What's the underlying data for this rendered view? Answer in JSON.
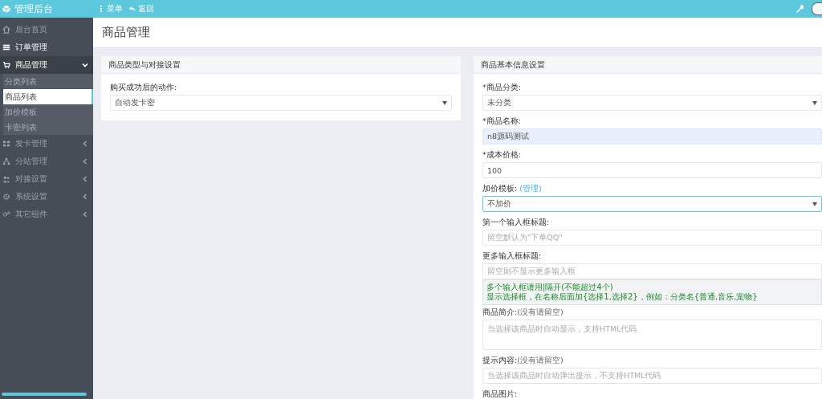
{
  "topbar": {
    "brand": "管理后台",
    "actions": [
      {
        "kind": "menu",
        "label": "菜单"
      },
      {
        "kind": "back",
        "label": "返回"
      }
    ]
  },
  "sidebar": {
    "items": [
      {
        "label": "后台首页",
        "active": false
      },
      {
        "label": "订单管理",
        "active": true
      },
      {
        "label": "商品管理",
        "active": false,
        "expanded": true,
        "children": [
          {
            "label": "分类列表",
            "selected": false
          },
          {
            "label": "商品列表",
            "selected": true
          },
          {
            "label": "加价模板",
            "selected": false
          },
          {
            "label": "卡密列表",
            "selected": false
          }
        ]
      },
      {
        "label": "发卡管理",
        "active": false,
        "expanded": false
      },
      {
        "label": "分站管理",
        "active": false,
        "expanded": false
      },
      {
        "label": "对接设置",
        "active": false,
        "expanded": false
      },
      {
        "label": "系统设置",
        "active": false,
        "expanded": false
      },
      {
        "label": "其它组件",
        "active": false,
        "expanded": false
      }
    ]
  },
  "page_title": "商品管理",
  "panels": [
    {
      "title": "商品类型与对接设置",
      "fields": [
        {
          "kind": "select",
          "label": "购买成功后的动作:",
          "value": "自动发卡密",
          "focused": false,
          "highlighted": false
        }
      ]
    },
    {
      "title": "商品基本信息设置",
      "fields": [
        {
          "kind": "select",
          "label": "*商品分类:",
          "value": "未分类",
          "focused": false,
          "highlighted": false
        },
        {
          "kind": "input",
          "label": "*商品名称:",
          "value": "n8源码测试",
          "focused": false,
          "highlighted": true
        },
        {
          "kind": "input",
          "label": "*成本价格:",
          "value": "100",
          "focused": false,
          "highlighted": false
        },
        {
          "kind": "select",
          "label": "加价模板:",
          "link": "(管理)",
          "value": "不加价",
          "focused": true,
          "highlighted": false
        },
        {
          "kind": "input",
          "label": "第一个输入框标题:",
          "placeholder": "留空默认为\"下单QQ\"",
          "focused": false,
          "highlighted": false
        },
        {
          "kind": "input",
          "label": "更多输入框标题:",
          "placeholder": "留空则不显示更多输入框",
          "focused": false,
          "highlighted": false
        },
        {
          "kind": "hint",
          "lines": [
            "多个输入框请用|隔开(不能超过4个)",
            "显示选择框，在名称后面加{选择1,选择2}，例如：分类名{普通,音乐,宠物}"
          ]
        },
        {
          "kind": "textarea",
          "label": "商品简介:",
          "note": "(没有请留空)",
          "placeholder": "当选择该商品时自动显示，支持HTML代码",
          "focused": false,
          "highlighted": false
        },
        {
          "kind": "input",
          "label": "提示内容:",
          "note": "(没有请留空)",
          "placeholder": "当选择该商品时自动弹出提示，不支持HTML代码",
          "focused": false,
          "highlighted": false
        },
        {
          "kind": "label",
          "label": "商品图片:"
        }
      ]
    }
  ]
}
